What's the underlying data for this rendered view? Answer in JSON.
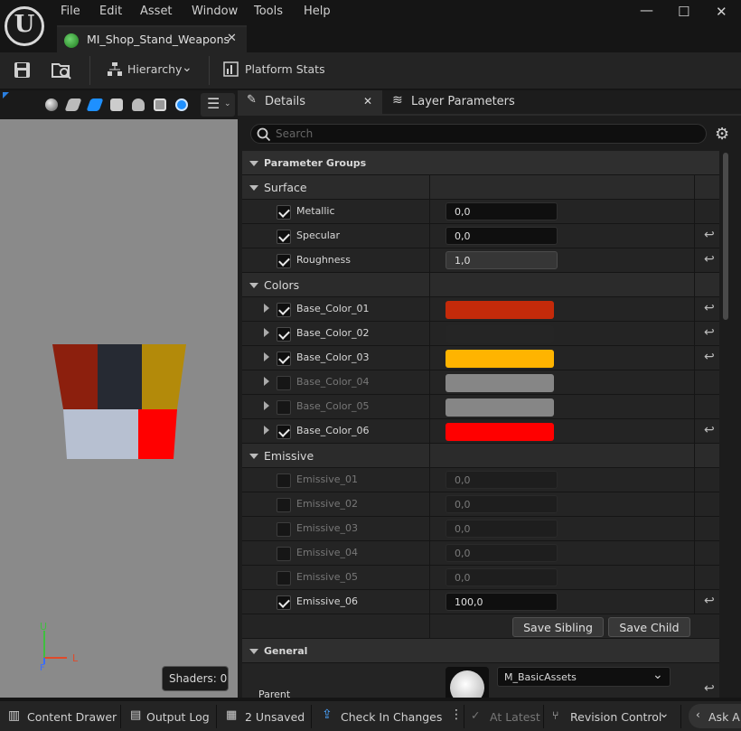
{
  "menu": [
    "File",
    "Edit",
    "Asset",
    "Window",
    "Tools",
    "Help"
  ],
  "document_tab": "MI_Shop_Stand_Weapons",
  "toolbar": {
    "hierarchy": "Hierarchy",
    "platform_stats": "Platform Stats"
  },
  "viewport": {
    "shaders": "Shaders: 0",
    "axis_up": "U",
    "axis_right": "L",
    "axis_front": "F",
    "preview_colors": [
      "#8c1f0d",
      "#262a33",
      "#b38a0a",
      "#b7c0d1",
      "#ff0000"
    ]
  },
  "panel_tabs": {
    "details": "Details",
    "layer_parameters": "Layer Parameters"
  },
  "search": {
    "placeholder": "Search"
  },
  "sections": {
    "parameter_groups": "Parameter Groups",
    "surface": "Surface",
    "colors": "Colors",
    "emissive": "Emissive",
    "general": "General"
  },
  "surface": [
    {
      "label": "Metallic",
      "value": "0,0",
      "checked": true,
      "reset": false
    },
    {
      "label": "Specular",
      "value": "0,0",
      "checked": true,
      "reset": true
    },
    {
      "label": "Roughness",
      "value": "1,0",
      "checked": true,
      "reset": true
    }
  ],
  "colors": [
    {
      "label": "Base_Color_01",
      "checked": true,
      "color": "#c42a0a",
      "reset": true
    },
    {
      "label": "Base_Color_02",
      "checked": true,
      "color": "#252525",
      "reset": true
    },
    {
      "label": "Base_Color_03",
      "checked": true,
      "color": "#ffb400",
      "reset": true
    },
    {
      "label": "Base_Color_04",
      "checked": false,
      "color": "#868686",
      "reset": false
    },
    {
      "label": "Base_Color_05",
      "checked": false,
      "color": "#868686",
      "reset": false
    },
    {
      "label": "Base_Color_06",
      "checked": true,
      "color": "#ff0000",
      "reset": true
    }
  ],
  "emissive": [
    {
      "label": "Emissive_01",
      "value": "0,0",
      "checked": false
    },
    {
      "label": "Emissive_02",
      "value": "0,0",
      "checked": false
    },
    {
      "label": "Emissive_03",
      "value": "0,0",
      "checked": false
    },
    {
      "label": "Emissive_04",
      "value": "0,0",
      "checked": false
    },
    {
      "label": "Emissive_05",
      "value": "0,0",
      "checked": false
    },
    {
      "label": "Emissive_06",
      "value": "100,0",
      "checked": true,
      "reset": true
    }
  ],
  "buttons": {
    "save_sibling": "Save Sibling",
    "save_child": "Save Child"
  },
  "general": {
    "parent_label": "Parent",
    "parent_value": "M_BasicAssets"
  },
  "status": {
    "content_drawer": "Content Drawer",
    "output_log": "Output Log",
    "unsaved": "2 Unsaved",
    "check_in": "Check In Changes",
    "at_latest": "At Latest",
    "revision_control": "Revision Control",
    "ask": "Ask AI"
  }
}
